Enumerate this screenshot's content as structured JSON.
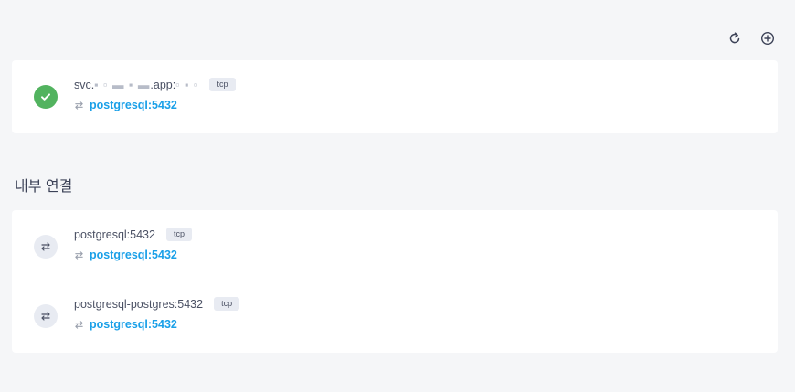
{
  "toolbar": {
    "refresh_icon": "refresh-icon",
    "add_icon": "add-circle-icon"
  },
  "external": {
    "host_prefix": "svc.",
    "host_masked_1": "▪ ▫ ▬ ▪ ▬",
    "host_mid": ".app:",
    "host_masked_2": "▫ ▪ ▫",
    "protocol": "tcp",
    "target": "postgresql:5432",
    "status": "ok"
  },
  "section": {
    "title": "내부 연결"
  },
  "internal": [
    {
      "name": "postgresql:5432",
      "protocol": "tcp",
      "target": "postgresql:5432"
    },
    {
      "name": "postgresql-postgres:5432",
      "protocol": "tcp",
      "target": "postgresql:5432"
    }
  ],
  "colors": {
    "accent": "#1aa0e8",
    "success": "#52b35f",
    "background": "#f5f6f8"
  }
}
